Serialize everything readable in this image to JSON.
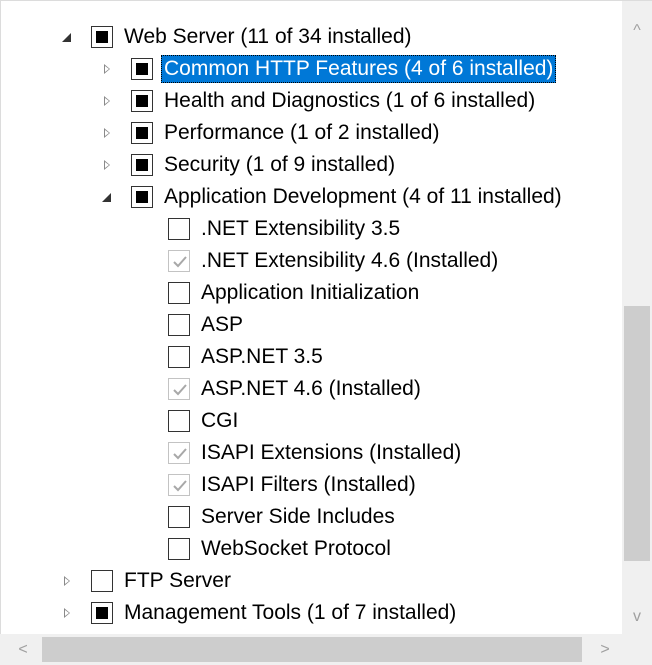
{
  "tree": {
    "web_server": {
      "label": "Web Server (11 of 34 installed)",
      "state": "partial",
      "expander": "expanded"
    },
    "common_http": {
      "label": "Common HTTP Features (4 of 6 installed)",
      "state": "partial",
      "expander": "collapsed",
      "selected": true
    },
    "health": {
      "label": "Health and Diagnostics (1 of 6 installed)",
      "state": "partial",
      "expander": "collapsed"
    },
    "performance": {
      "label": "Performance (1 of 2 installed)",
      "state": "partial",
      "expander": "collapsed"
    },
    "security": {
      "label": "Security (1 of 9 installed)",
      "state": "partial",
      "expander": "collapsed"
    },
    "app_dev": {
      "label": "Application Development (4 of 11 installed)",
      "state": "partial",
      "expander": "expanded"
    },
    "net35": {
      "label": ".NET Extensibility 3.5",
      "state": "unchecked"
    },
    "net46": {
      "label": ".NET Extensibility 4.6 (Installed)",
      "state": "checked-disabled"
    },
    "app_init": {
      "label": "Application Initialization",
      "state": "unchecked"
    },
    "asp": {
      "label": "ASP",
      "state": "unchecked"
    },
    "aspnet35": {
      "label": "ASP.NET 3.5",
      "state": "unchecked"
    },
    "aspnet46": {
      "label": "ASP.NET 4.6 (Installed)",
      "state": "checked-disabled"
    },
    "cgi": {
      "label": "CGI",
      "state": "unchecked"
    },
    "isapi_ext": {
      "label": "ISAPI Extensions (Installed)",
      "state": "checked-disabled"
    },
    "isapi_filters": {
      "label": "ISAPI Filters (Installed)",
      "state": "checked-disabled"
    },
    "ssi": {
      "label": "Server Side Includes",
      "state": "unchecked"
    },
    "websocket": {
      "label": "WebSocket Protocol",
      "state": "unchecked"
    },
    "ftp": {
      "label": "FTP Server",
      "state": "unchecked",
      "expander": "collapsed"
    },
    "mgmt": {
      "label": "Management Tools (1 of 7 installed)",
      "state": "partial",
      "expander": "collapsed"
    }
  },
  "scrollbars": {
    "up_arrow": "^",
    "down_arrow": "v",
    "left_arrow": "<",
    "right_arrow": ">"
  },
  "colors": {
    "selection": "#0078d7",
    "scroll_track": "#f0f0f0",
    "scroll_thumb": "#cdcdcd"
  },
  "icons": {
    "expander_collapsed": "collapsed-triangle-icon",
    "expander_expanded": "expanded-triangle-icon",
    "check": "check-icon"
  }
}
